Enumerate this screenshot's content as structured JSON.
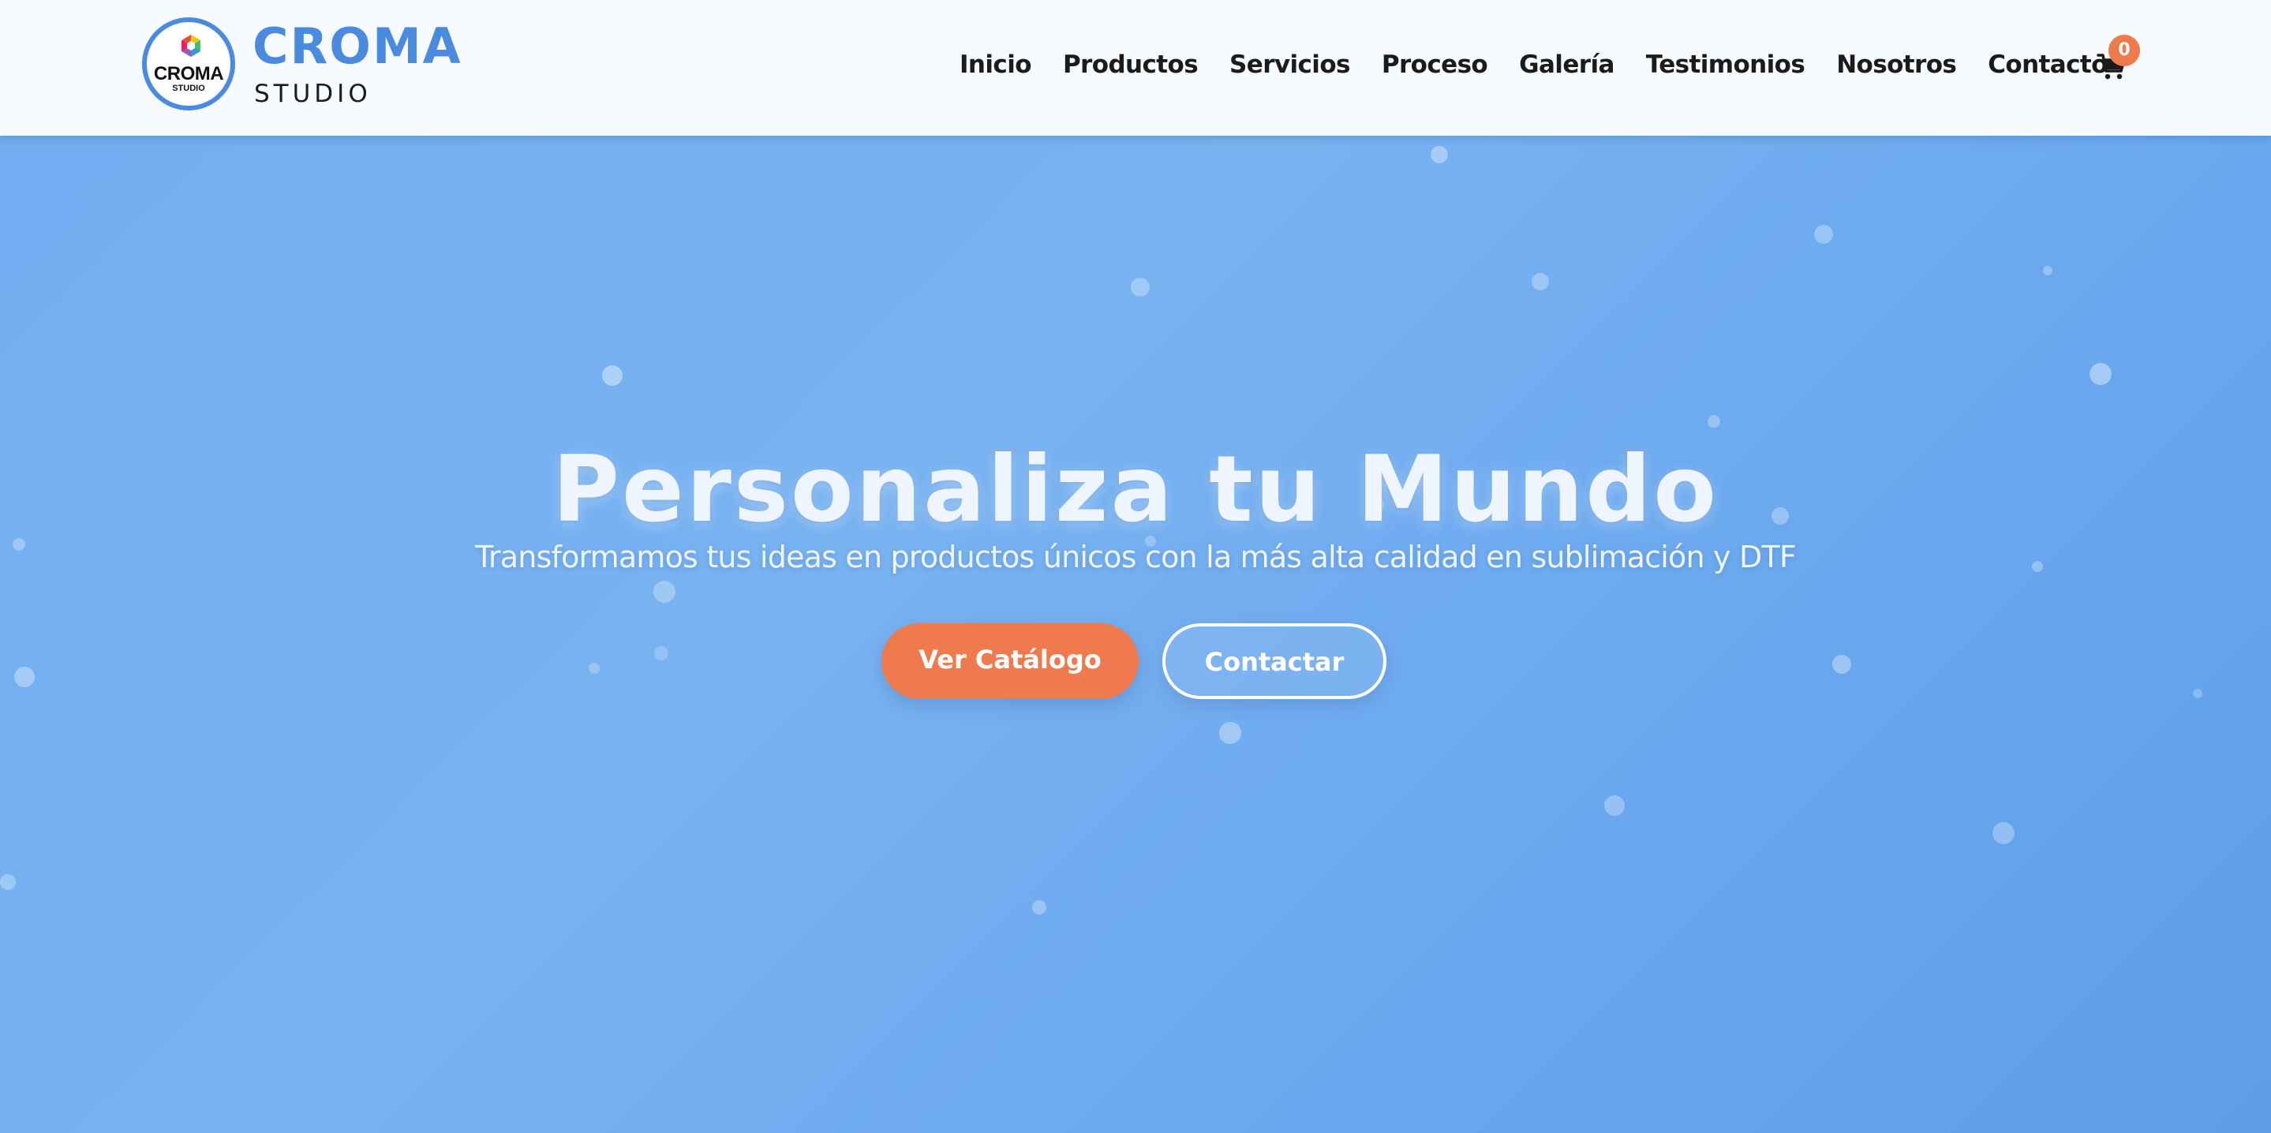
{
  "header": {
    "logo_text": "CROMA",
    "logo_subtext": "STUDIO",
    "brand_name": "CROMA",
    "brand_sub": "STUDIO"
  },
  "nav": {
    "items": [
      "Inicio",
      "Productos",
      "Servicios",
      "Proceso",
      "Galería",
      "Testimonios",
      "Nosotros",
      "Contacto"
    ]
  },
  "cart": {
    "icon": "cart-icon",
    "count": "0"
  },
  "hero": {
    "title": "Personaliza tu Mundo",
    "subtitle": "Transformamos tus ideas en productos únicos con la más alta calidad en sublimación y DTF",
    "primary_button": "Ver Catálogo",
    "secondary_button": "Contactar"
  },
  "colors": {
    "brand_blue": "#4a8be0",
    "hero_blue": "#72aef1",
    "accent_orange": "#ef7a4d",
    "header_bg": "#f8fbfe"
  }
}
